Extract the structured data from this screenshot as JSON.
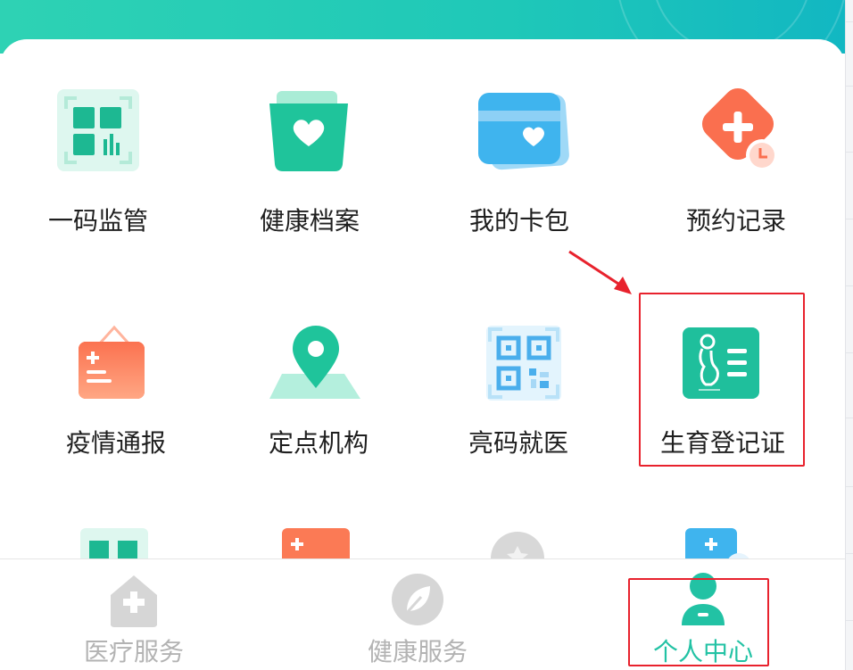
{
  "grid": {
    "items": [
      {
        "label": "一码监管",
        "icon": "qr-supervision-icon"
      },
      {
        "label": "健康档案",
        "icon": "health-file-icon"
      },
      {
        "label": "我的卡包",
        "icon": "card-wallet-icon"
      },
      {
        "label": "预约记录",
        "icon": "appointment-record-icon"
      },
      {
        "label": "疫情通报",
        "icon": "epidemic-report-icon"
      },
      {
        "label": "定点机构",
        "icon": "location-pin-icon"
      },
      {
        "label": "亮码就医",
        "icon": "qr-code-icon"
      },
      {
        "label": "生育登记证",
        "icon": "pregnancy-certificate-icon"
      }
    ]
  },
  "bottom_nav": {
    "items": [
      {
        "label": "医疗服务",
        "icon": "hospital-icon",
        "active": false
      },
      {
        "label": "健康服务",
        "icon": "leaf-icon",
        "active": false
      },
      {
        "label": "个人中心",
        "icon": "person-icon",
        "active": true
      }
    ]
  },
  "colors": {
    "header_start": "#2ed2b4",
    "header_end": "#12b7c2",
    "accent": "#22c2a4",
    "highlight": "#e8222d",
    "nav_inactive": "#b3b3b3"
  }
}
